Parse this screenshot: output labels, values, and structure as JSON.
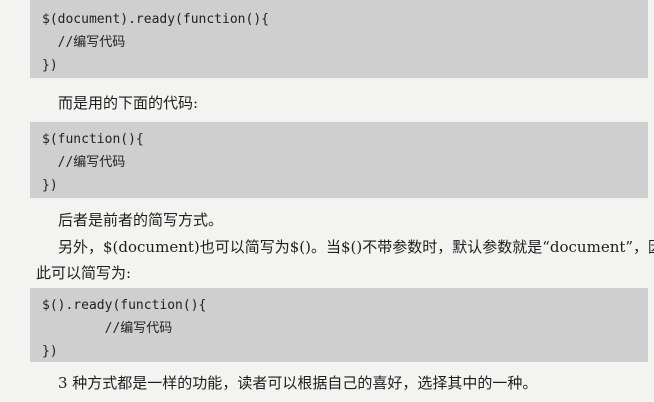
{
  "code1": {
    "lines": [
      "$(document).ready(function(){",
      "  //编写代码",
      "})"
    ]
  },
  "para1": "而是用的下面的代码:",
  "code2": {
    "lines": [
      "$(function(){",
      "  //编写代码",
      "})"
    ]
  },
  "para2": "后者是前者的简写方式。",
  "para3_line1": "另外，$(document)也可以简写为$()。当$()不带参数时，默认参数就是“document”，因",
  "para3_line2": "此可以简写为:",
  "code3": {
    "lines": [
      "$().ready(function(){",
      "        //编写代码",
      "})"
    ]
  },
  "para4": "3 种方式都是一样的功能，读者可以根据自己的喜好，选择其中的一种。"
}
